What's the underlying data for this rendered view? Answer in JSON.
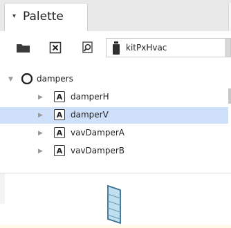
{
  "palette": {
    "title": "Palette",
    "module_select": {
      "value": "kitPxHvac"
    }
  },
  "tree": {
    "root": {
      "label": "dampers",
      "expanded": true
    },
    "items": [
      {
        "label": "damperH",
        "selected": false
      },
      {
        "label": "damperV",
        "selected": true
      },
      {
        "label": "vavDamperA",
        "selected": false
      },
      {
        "label": "vavDamperB",
        "selected": false
      }
    ],
    "item_icon_letter": "A"
  },
  "icons": {
    "open": "folder-icon",
    "close": "close-box-icon",
    "find": "find-icon",
    "module": "jar-icon",
    "preview": "vertical-damper-icon"
  },
  "colors": {
    "selection": "#cfe0fa",
    "preview_damper_frame": "#3a6f8f",
    "preview_damper_fill": "#bfe0ee"
  }
}
